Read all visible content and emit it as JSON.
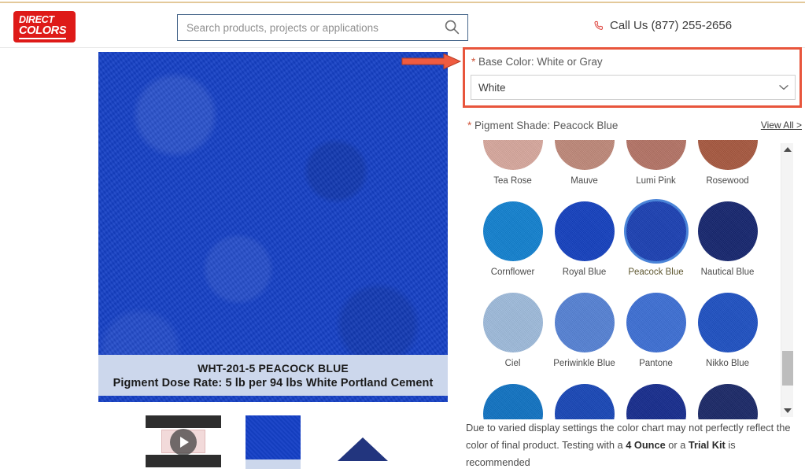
{
  "header": {
    "logo_line1": "DIRECT",
    "logo_line2": "COLORS",
    "logo_bg": "#de1a18",
    "search_placeholder": "Search products, projects or applications",
    "search_value": "",
    "search_icon": "search-icon",
    "phone_icon": "phone-icon",
    "call_text": "Call Us (877) 255-2656"
  },
  "product_image": {
    "swatch_color": "#1540c6",
    "caption_line1": "WHT-201-5 PEACOCK BLUE",
    "caption_line2": "Pigment Dose Rate: 5 lb per 94 lbs White Portland Cement",
    "caption_bg": "#ccd7ec"
  },
  "thumbnails": [
    {
      "type": "video",
      "name": "video-thumbnail",
      "icon": "play-icon"
    },
    {
      "type": "image",
      "name": "blue-slab-thumbnail",
      "color": "#1540c6"
    },
    {
      "type": "image",
      "name": "pigment-powder-thumbnail",
      "color": "#22357e"
    }
  ],
  "base_color": {
    "required_marker": "*",
    "label": "Base Color: White or Gray",
    "selected": "White",
    "caret_icon": "chevron-down-icon",
    "highlight_color": "#e8553c",
    "annotation_icon": "red-arrow-annotation"
  },
  "pigment_shade": {
    "required_marker": "*",
    "label": "Pigment Shade: Peacock Blue",
    "view_all": "View All >",
    "selected": "Peacock Blue",
    "selection_ring_color": "#4a84d8",
    "swatches": [
      {
        "name": "Tea Rose",
        "color": "#d9a99e"
      },
      {
        "name": "Mauve",
        "color": "#c0897a"
      },
      {
        "name": "Lumi Pink",
        "color": "#b57466"
      },
      {
        "name": "Rosewood",
        "color": "#a8583f"
      },
      {
        "name": "Cornflower",
        "color": "#1181d1"
      },
      {
        "name": "Royal Blue",
        "color": "#1340c0"
      },
      {
        "name": "Peacock Blue",
        "color": "#1a40b4"
      },
      {
        "name": "Nautical Blue",
        "color": "#14246e"
      },
      {
        "name": "Ciel",
        "color": "#9fbcdd"
      },
      {
        "name": "Periwinkle Blue",
        "color": "#5582d6"
      },
      {
        "name": "Pantone",
        "color": "#3c6fd6"
      },
      {
        "name": "Nikko Blue",
        "color": "#1d50c4"
      },
      {
        "name": "",
        "color": "#0f73c4"
      },
      {
        "name": "",
        "color": "#1746b8"
      },
      {
        "name": "",
        "color": "#152b8e"
      },
      {
        "name": "",
        "color": "#192767"
      }
    ]
  },
  "scrollbar": {
    "up_icon": "scroll-up-arrow-icon",
    "down_icon": "scroll-down-arrow-icon",
    "thumb": "scrollbar-thumb"
  },
  "disclaimer": {
    "part1": "Due to varied display settings the color chart may not perfectly reflect the color of final product. Testing with a ",
    "bold1": "4 Ounce",
    "part2": " or a ",
    "bold2": "Trial Kit",
    "part3": " is recommended"
  }
}
